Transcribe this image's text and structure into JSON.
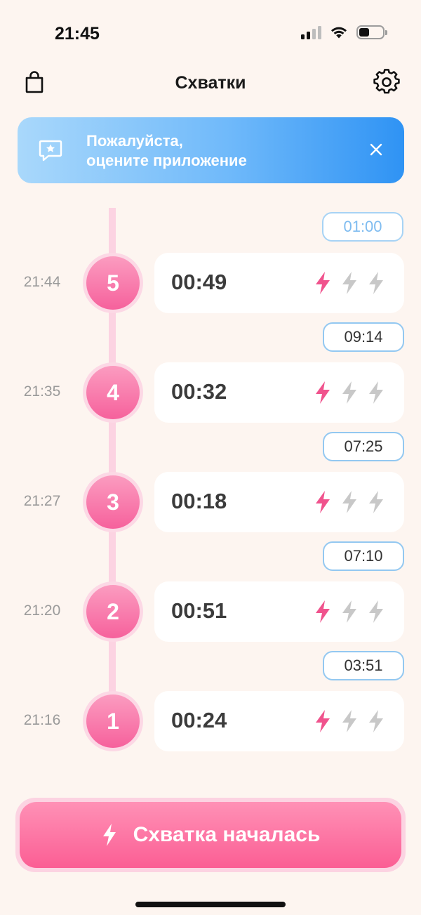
{
  "status_bar": {
    "time": "21:45"
  },
  "nav": {
    "title": "Схватки",
    "left_icon": "bag-icon",
    "right_icon": "gear-icon"
  },
  "banner": {
    "line1": "Пожалуйста,",
    "line2": "оцените приложение",
    "icon": "rate-feedback-icon",
    "close_icon": "close-icon"
  },
  "current_interval": "01:00",
  "contractions": [
    {
      "number": "5",
      "time": "21:44",
      "duration": "00:49",
      "intensity": 1,
      "interval_before": "09:14"
    },
    {
      "number": "4",
      "time": "21:35",
      "duration": "00:32",
      "intensity": 1,
      "interval_before": "07:25"
    },
    {
      "number": "3",
      "time": "21:27",
      "duration": "00:18",
      "intensity": 1,
      "interval_before": "07:10"
    },
    {
      "number": "2",
      "time": "21:20",
      "duration": "00:51",
      "intensity": 1,
      "interval_before": "03:51"
    },
    {
      "number": "1",
      "time": "21:16",
      "duration": "00:24",
      "intensity": 1
    }
  ],
  "intensity_max": 3,
  "main_button": {
    "label": "Схватка началась",
    "icon": "bolt-icon"
  },
  "colors": {
    "background": "#fdf5f0",
    "accent_pink": "#f6619c",
    "accent_blue": "#2f93f4",
    "bolt_active": "#f0538d",
    "bolt_inactive": "#c8c8c8"
  }
}
